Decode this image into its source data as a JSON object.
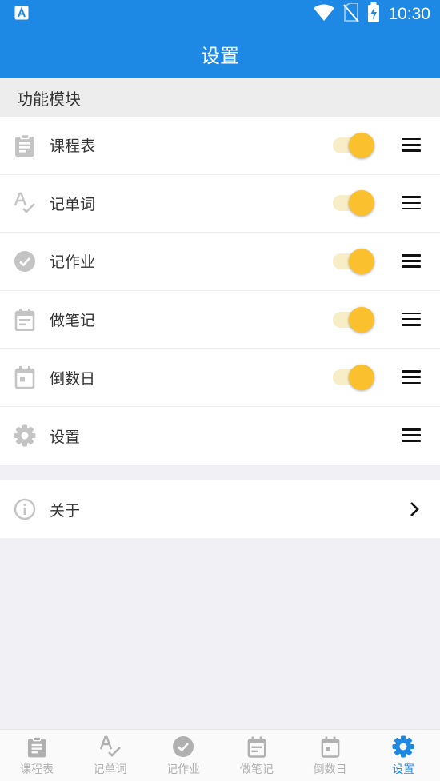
{
  "status_bar": {
    "time": "10:30"
  },
  "app_bar": {
    "title": "设置"
  },
  "section": {
    "title": "功能模块"
  },
  "modules": [
    {
      "label": "课程表",
      "icon": "clipboard-icon",
      "toggle": true
    },
    {
      "label": "记单词",
      "icon": "spellcheck-icon",
      "toggle": true
    },
    {
      "label": "记作业",
      "icon": "check-circle-icon",
      "toggle": true
    },
    {
      "label": "做笔记",
      "icon": "note-calendar-icon",
      "toggle": true
    },
    {
      "label": "倒数日",
      "icon": "event-calendar-icon",
      "toggle": true
    },
    {
      "label": "设置",
      "icon": "gear-icon",
      "toggle": false
    }
  ],
  "about": {
    "label": "关于"
  },
  "bottom_nav": [
    {
      "label": "课程表",
      "active": false
    },
    {
      "label": "记单词",
      "active": false
    },
    {
      "label": "记作业",
      "active": false
    },
    {
      "label": "做笔记",
      "active": false
    },
    {
      "label": "倒数日",
      "active": false
    },
    {
      "label": "设置",
      "active": true
    }
  ],
  "colors": {
    "primary": "#1e88e5",
    "toggle_on": "#fbc02d",
    "toggle_track": "#f7edc6",
    "nav_inactive": "#b0b0b0",
    "icon_gray": "#c4c4c4"
  }
}
